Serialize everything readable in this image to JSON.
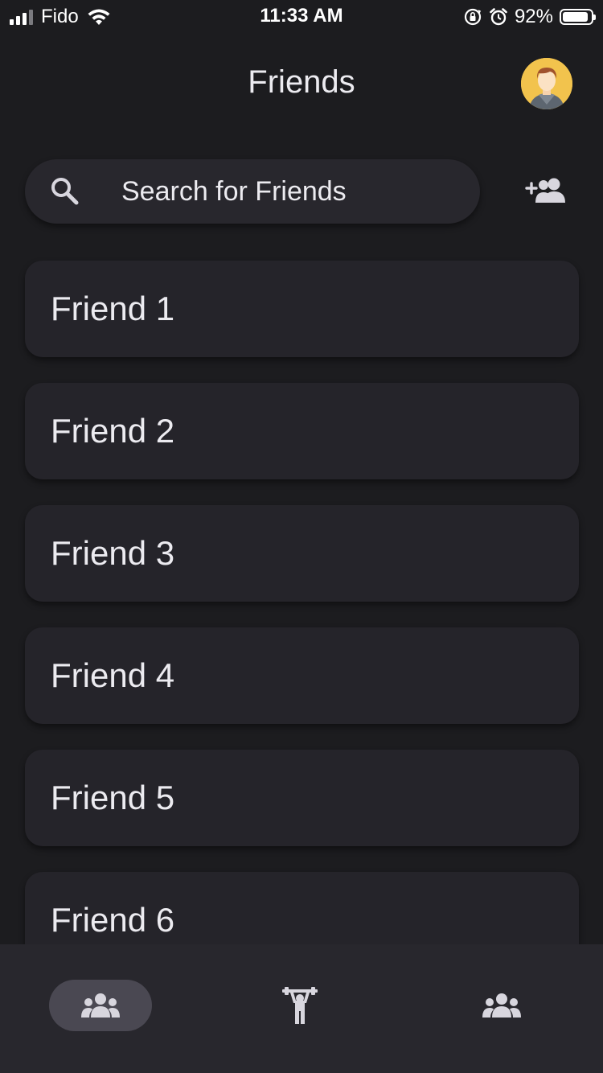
{
  "status_bar": {
    "carrier": "Fido",
    "time": "11:33 AM",
    "battery_percent": "92%",
    "battery_level": 0.92,
    "signal_bars_active": 3,
    "signal_bars_total": 4
  },
  "header": {
    "title": "Friends",
    "avatar_icon": "user-avatar-icon"
  },
  "search": {
    "placeholder": "Search for Friends",
    "value": "",
    "icon": "search-icon",
    "add_friend_icon": "add-friend-icon"
  },
  "friends": [
    {
      "name": "Friend 1"
    },
    {
      "name": "Friend 2"
    },
    {
      "name": "Friend 3"
    },
    {
      "name": "Friend 4"
    },
    {
      "name": "Friend 5"
    },
    {
      "name": "Friend 6"
    }
  ],
  "bottom_nav": {
    "items": [
      {
        "icon": "friends-icon",
        "active": true
      },
      {
        "icon": "weightlifting-icon",
        "active": false
      },
      {
        "icon": "groups-icon",
        "active": false
      }
    ]
  },
  "colors": {
    "background": "#1c1c1f",
    "card": "#25242a",
    "search_bg": "#28272d",
    "nav_bg": "#28272d",
    "nav_active_pill": "#4a4852",
    "text": "#ecebf0",
    "icon": "#d8d6de",
    "avatar_bg": "#f2c34d"
  }
}
